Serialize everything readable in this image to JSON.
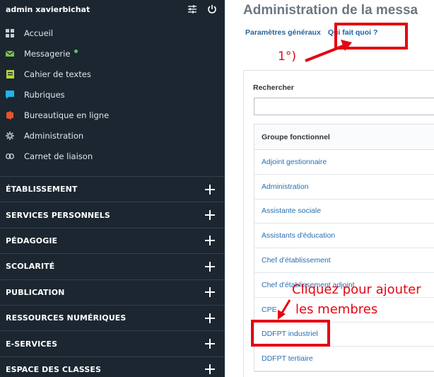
{
  "sidebar": {
    "user": "admin xavierbichat",
    "nav_items": [
      {
        "label": "Accueil",
        "icon": "grid-icon",
        "color": "#c7ced4"
      },
      {
        "label": "Messagerie",
        "icon": "envelope-icon",
        "color": "#7dc242"
      },
      {
        "label": "Cahier de textes",
        "icon": "notebook-icon",
        "color": "#b7d433"
      },
      {
        "label": "Rubriques",
        "icon": "chat-bubble-icon",
        "color": "#1fb5e8"
      },
      {
        "label": "Bureautique en ligne",
        "icon": "office-icon",
        "color": "#e8542a"
      },
      {
        "label": "Administration",
        "icon": "gear-icon",
        "color": "#9aa4ad"
      },
      {
        "label": "Carnet de liaison",
        "icon": "link-icon",
        "color": "#c7ced4"
      }
    ],
    "sections": [
      "ÉTABLISSEMENT",
      "SERVICES PERSONNELS",
      "PÉDAGOGIE",
      "SCOLARITÉ",
      "PUBLICATION",
      "RESSOURCES NUMÉRIQUES",
      "E-SERVICES",
      "ESPACE DES CLASSES"
    ]
  },
  "main": {
    "title": "Administration de la messa",
    "tabs": [
      {
        "label": "Paramètres généraux"
      },
      {
        "label": "Qui fait quoi ?"
      }
    ],
    "search": {
      "label": "Rechercher",
      "placeholder": "",
      "value": ""
    },
    "table": {
      "header": "Groupe fonctionnel",
      "rows": [
        "Adjoint gestionnaire",
        "Administration",
        "Assistante sociale",
        "Assistants d'éducation",
        "Chef d'établissement",
        "Chef d'établissement adjoint",
        "CPE",
        "DDFPT industriel",
        "DDFPT tertiaire"
      ]
    }
  },
  "annotations": {
    "step": "1°)",
    "hint_line1": "Cliquez pour ajouter",
    "hint_line2": "les membres",
    "color": "#e30613"
  }
}
